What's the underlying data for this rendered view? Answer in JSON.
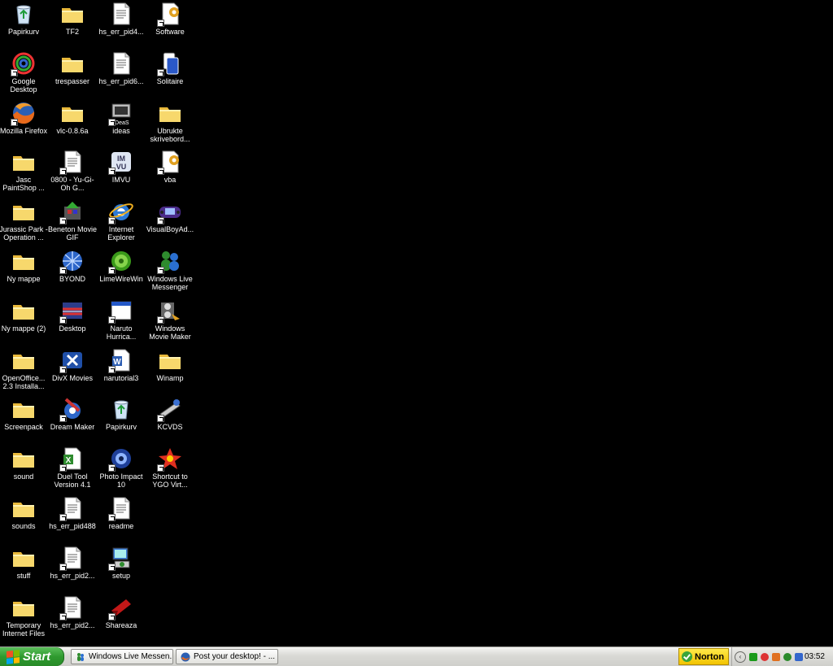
{
  "desktop": {
    "icons": [
      {
        "label": "Papirkurv",
        "type": "recycle"
      },
      {
        "label": "TF2",
        "type": "folder"
      },
      {
        "label": "hs_err_pid4...",
        "type": "doc"
      },
      {
        "label": "Software",
        "type": "gear"
      },
      {
        "label": "Google Desktop",
        "type": "google"
      },
      {
        "label": "trespasser",
        "type": "folder"
      },
      {
        "label": "hs_err_pid6...",
        "type": "doc"
      },
      {
        "label": "Solitaire",
        "type": "solitaire"
      },
      {
        "label": "Mozilla Firefox",
        "type": "firefox"
      },
      {
        "label": "vlc-0.8.6a",
        "type": "folder"
      },
      {
        "label": "ideas",
        "type": "ideas"
      },
      {
        "label": "Ubrukte skrivebord...",
        "type": "folder"
      },
      {
        "label": "Jasc PaintShop ...",
        "type": "folder"
      },
      {
        "label": "0800 - Yu-Gi-Oh G...",
        "type": "doc"
      },
      {
        "label": "IMVU",
        "type": "imvu"
      },
      {
        "label": "vba",
        "type": "gear"
      },
      {
        "label": "Jurassic Park - Operation ...",
        "type": "folder"
      },
      {
        "label": "Beneton Movie GIF",
        "type": "beneton"
      },
      {
        "label": "Internet Explorer",
        "type": "ie"
      },
      {
        "label": "VisualBoyAd...",
        "type": "gba"
      },
      {
        "label": "Ny mappe",
        "type": "folder"
      },
      {
        "label": "BYOND",
        "type": "byond"
      },
      {
        "label": "LimeWireWin",
        "type": "limewire"
      },
      {
        "label": "Windows Live Messenger",
        "type": "messenger"
      },
      {
        "label": "Ny mappe (2)",
        "type": "folder"
      },
      {
        "label": "Desktop",
        "type": "desktopimg"
      },
      {
        "label": "Naruto Hurrica...",
        "type": "window"
      },
      {
        "label": "Windows Movie Maker",
        "type": "moviemaker"
      },
      {
        "label": "OpenOffice... 2.3 Installa...",
        "type": "folder"
      },
      {
        "label": "DivX Movies",
        "type": "divx"
      },
      {
        "label": "narutorial3",
        "type": "word"
      },
      {
        "label": "Winamp",
        "type": "folder"
      },
      {
        "label": "Screenpack",
        "type": "folder"
      },
      {
        "label": "Dream Maker",
        "type": "dreammaker"
      },
      {
        "label": "Papirkurv",
        "type": "recycle"
      },
      {
        "label": "KCVDS",
        "type": "kcvds"
      },
      {
        "label": "sound",
        "type": "folder"
      },
      {
        "label": "Duel Tool Version 4.1",
        "type": "excel"
      },
      {
        "label": "Photo Impact 10",
        "type": "photoimpact"
      },
      {
        "label": "Shortcut to YGO Virt...",
        "type": "ygo"
      },
      {
        "label": "sounds",
        "type": "folder"
      },
      {
        "label": "hs_err_pid488",
        "type": "doc"
      },
      {
        "label": "readme",
        "type": "doc"
      },
      {
        "label": "",
        "type": "none"
      },
      {
        "label": "stuff",
        "type": "folder"
      },
      {
        "label": "hs_err_pid2...",
        "type": "doc"
      },
      {
        "label": "setup",
        "type": "setup"
      },
      {
        "label": "",
        "type": "none"
      },
      {
        "label": "Temporary Internet Files",
        "type": "folder"
      },
      {
        "label": "hs_err_pid2...",
        "type": "doc"
      },
      {
        "label": "Shareaza",
        "type": "shareaza"
      },
      {
        "label": "",
        "type": "none"
      }
    ]
  },
  "taskbar": {
    "start_label": "Start",
    "tasks": [
      {
        "label": "Windows Live Messen...",
        "icon": "messenger-icon"
      },
      {
        "label": "Post your desktop! - ...",
        "icon": "firefox-icon"
      }
    ],
    "norton_label": "Norton",
    "clock": "03:52"
  },
  "colors": {
    "desktop_bg": "#000000",
    "start_green": "#2f9a2f",
    "folder_yellow": "#f5d46a",
    "norton_yellow": "#f2c300"
  }
}
